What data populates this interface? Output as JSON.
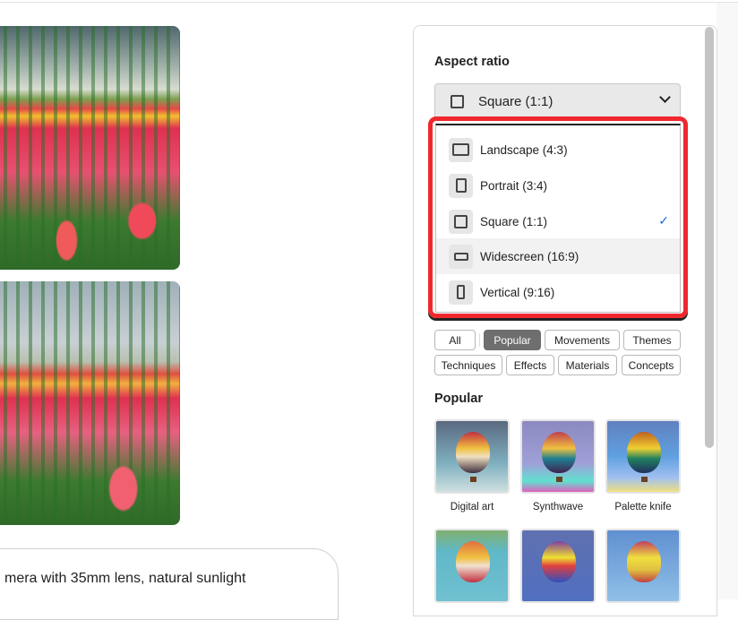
{
  "prompt": {
    "text": "mera with 35mm lens, natural sunlight"
  },
  "panel": {
    "aspect_title": "Aspect ratio",
    "selected": "Square (1:1)",
    "options": [
      {
        "label": "Landscape (4:3)",
        "icon": "landscape-icon"
      },
      {
        "label": "Portrait (3:4)",
        "icon": "portrait-icon"
      },
      {
        "label": "Square (1:1)",
        "icon": "square-icon",
        "checked": true
      },
      {
        "label": "Widescreen (16:9)",
        "icon": "widescreen-icon",
        "hovered": true
      },
      {
        "label": "Vertical (9:16)",
        "icon": "vertical-icon"
      }
    ],
    "check": "✓",
    "chips": [
      "All",
      "Popular",
      "Movements",
      "Themes",
      "Techniques",
      "Effects",
      "Materials",
      "Concepts"
    ],
    "active_chip": "Popular",
    "section_title": "Popular",
    "styles": [
      "Digital art",
      "Synthwave",
      "Palette knife"
    ],
    "highlight_color": "#f0282e",
    "accent": "#1473e6"
  }
}
